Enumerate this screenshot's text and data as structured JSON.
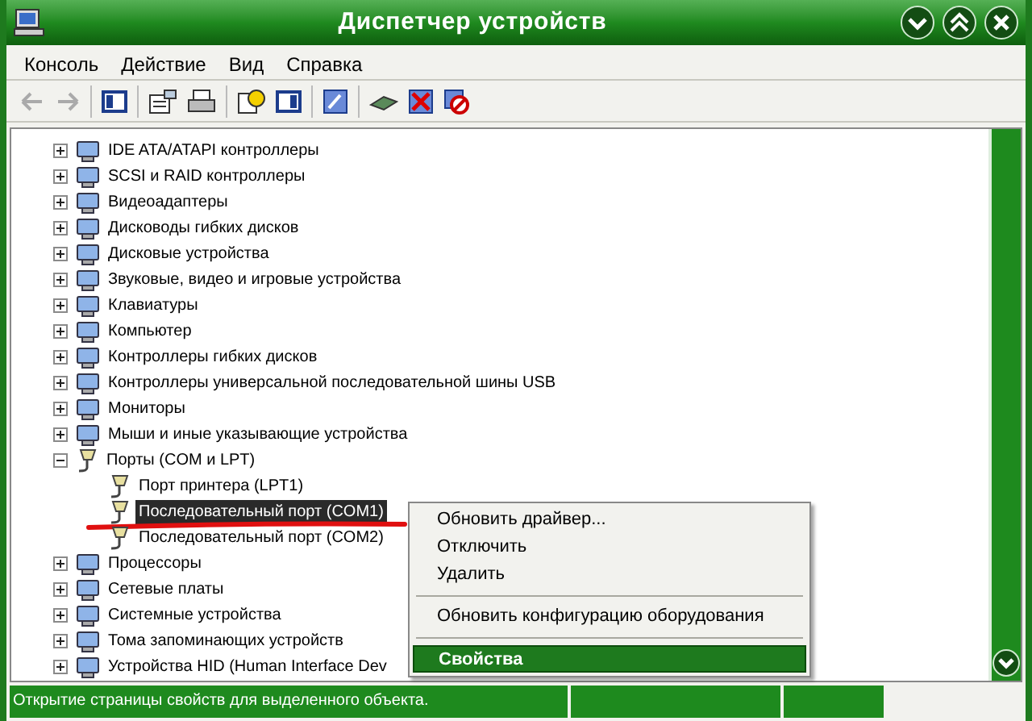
{
  "window": {
    "title": "Диспетчер устройств"
  },
  "menu": [
    "Консоль",
    "Действие",
    "Вид",
    "Справка"
  ],
  "tree": {
    "items": [
      {
        "label": "IDE ATA/ATAPI контроллеры",
        "expanded": false,
        "selected": false
      },
      {
        "label": "SCSI и RAID контроллеры",
        "expanded": false,
        "selected": false
      },
      {
        "label": "Видеоадаптеры",
        "expanded": false,
        "selected": false
      },
      {
        "label": "Дисководы гибких дисков",
        "expanded": false,
        "selected": false
      },
      {
        "label": "Дисковые устройства",
        "expanded": false,
        "selected": false
      },
      {
        "label": "Звуковые, видео и игровые устройства",
        "expanded": false,
        "selected": false
      },
      {
        "label": "Клавиатуры",
        "expanded": false,
        "selected": false
      },
      {
        "label": "Компьютер",
        "expanded": false,
        "selected": false
      },
      {
        "label": "Контроллеры гибких дисков",
        "expanded": false,
        "selected": false
      },
      {
        "label": "Контроллеры универсальной последовательной шины USB",
        "expanded": false,
        "selected": false
      },
      {
        "label": "Мониторы",
        "expanded": false,
        "selected": false
      },
      {
        "label": "Мыши и иные указывающие устройства",
        "expanded": false,
        "selected": false
      },
      {
        "label": "Порты (COM и LPT)",
        "expanded": true,
        "selected": false,
        "children": [
          {
            "label": "Порт принтера (LPT1)",
            "selected": false
          },
          {
            "label": "Последовательный порт (COM1)",
            "selected": true
          },
          {
            "label": "Последовательный порт (COM2)",
            "selected": false
          }
        ]
      },
      {
        "label": "Процессоры",
        "expanded": false,
        "selected": false
      },
      {
        "label": "Сетевые платы",
        "expanded": false,
        "selected": false
      },
      {
        "label": "Системные устройства",
        "expanded": false,
        "selected": false
      },
      {
        "label": "Тома запоминающих устройств",
        "expanded": false,
        "selected": false
      },
      {
        "label": "Устройства HID (Human Interface Dev",
        "expanded": false,
        "selected": false
      }
    ]
  },
  "context_menu": {
    "items": [
      {
        "label": "Обновить драйвер...",
        "selected": false,
        "separator_before": false
      },
      {
        "label": "Отключить",
        "selected": false,
        "separator_before": false
      },
      {
        "label": "Удалить",
        "selected": false,
        "separator_before": false
      },
      {
        "label": "Обновить конфигурацию оборудования",
        "selected": false,
        "separator_before": true
      },
      {
        "label": "Свойства",
        "selected": true,
        "separator_before": true
      }
    ]
  },
  "status_bar": {
    "text": "Открытие страницы свойств для выделенного объекта."
  }
}
